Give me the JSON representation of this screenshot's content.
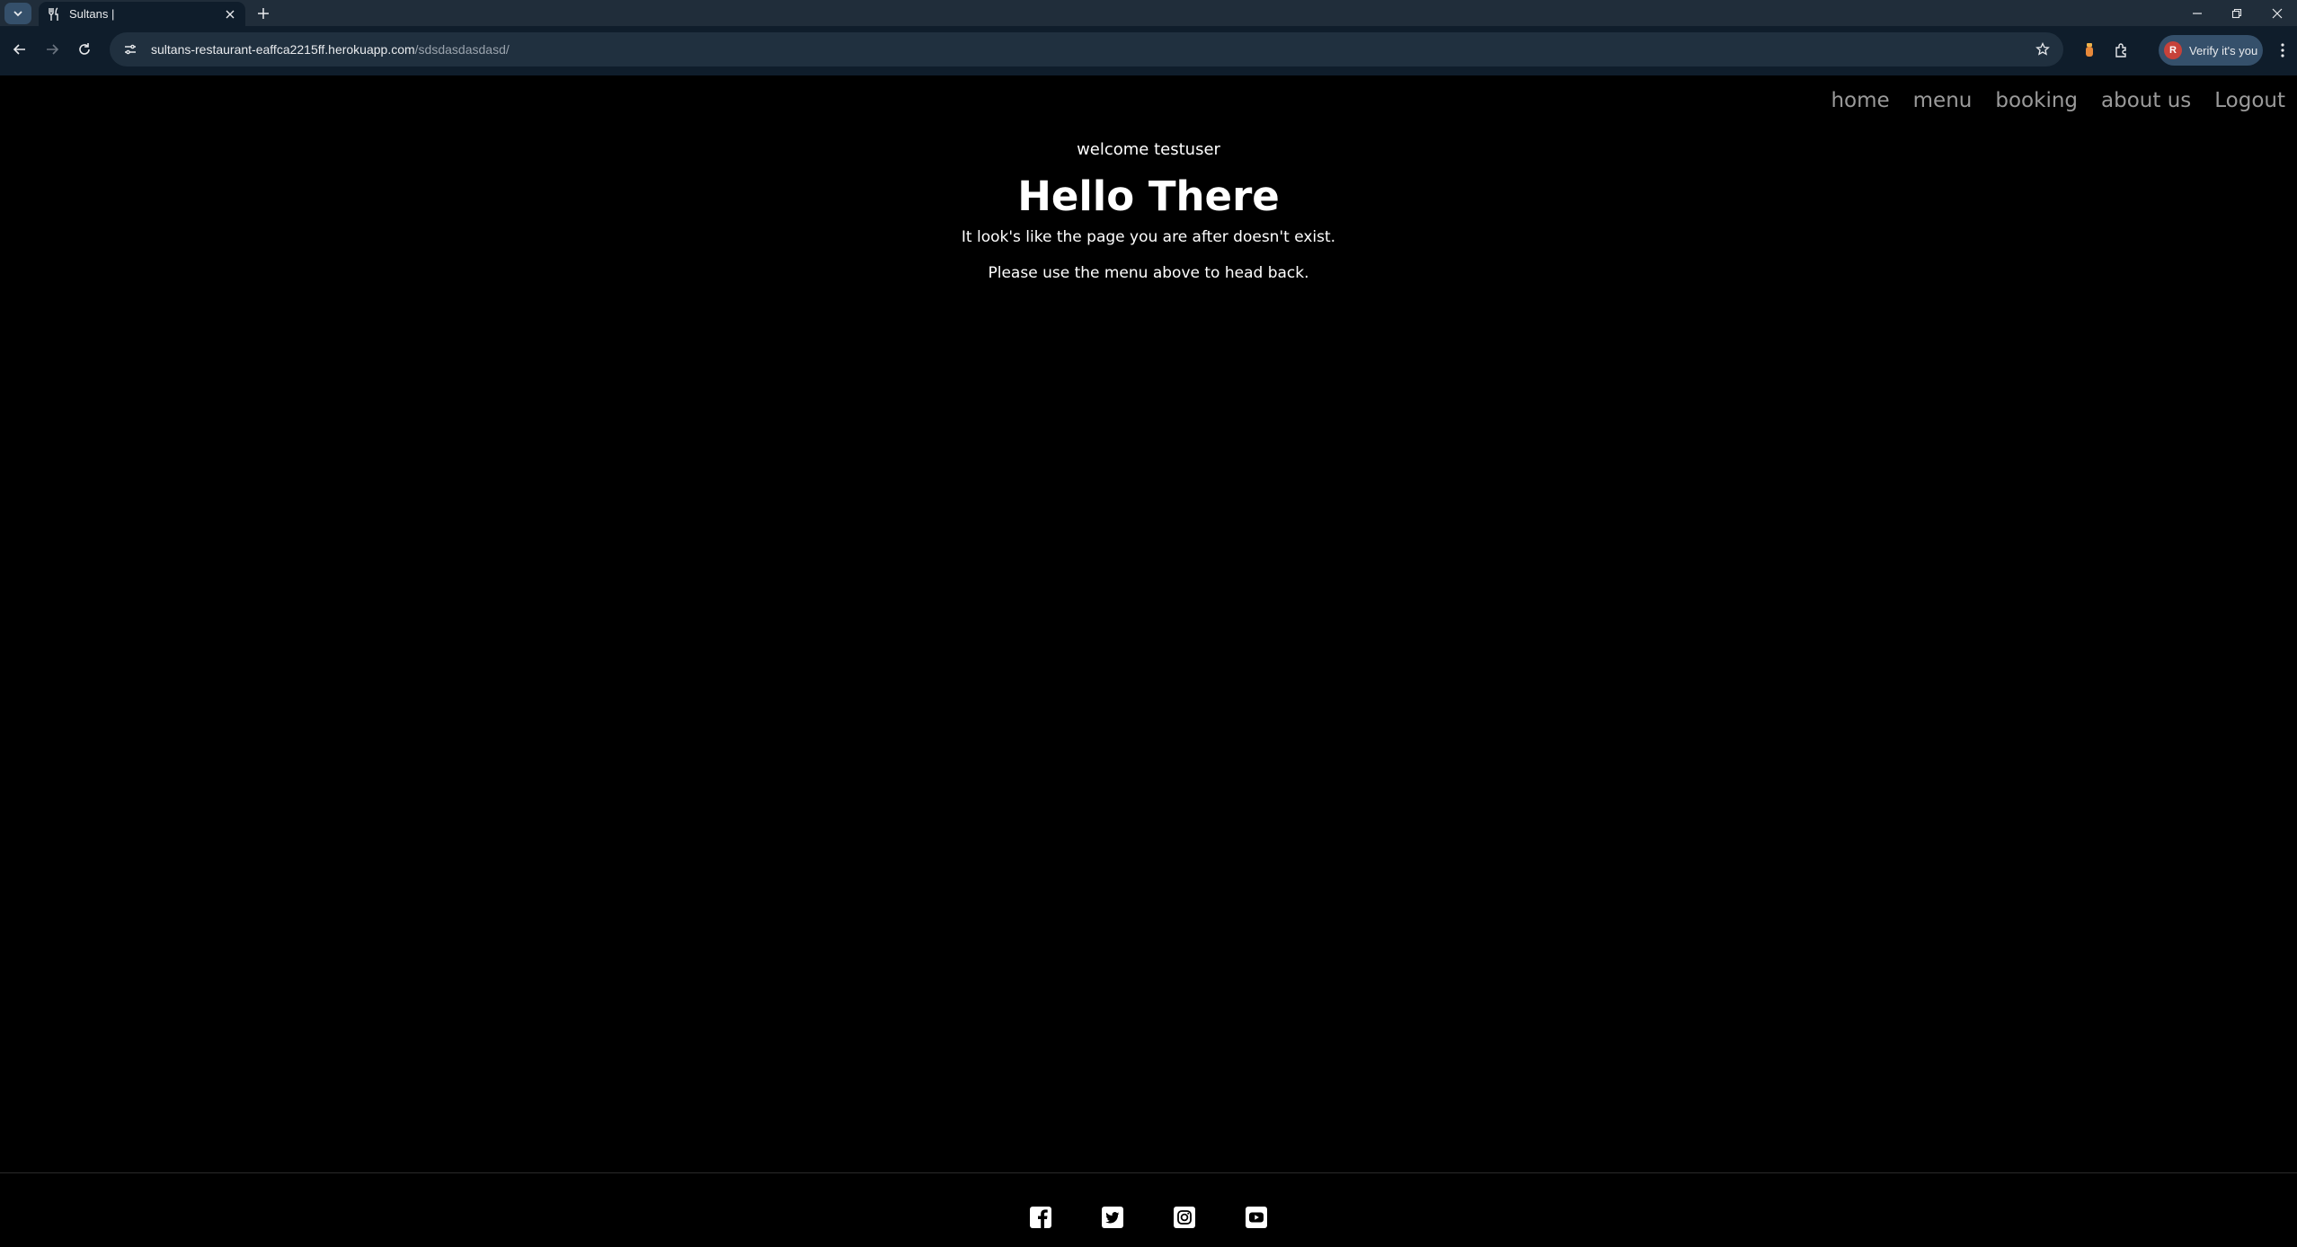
{
  "browser": {
    "tab": {
      "title": "Sultans |"
    },
    "address": {
      "host": "sultans-restaurant-eaffca2215ff.herokuapp.com",
      "path": "/sdsdasdasdasd/"
    },
    "profile": {
      "initial": "R",
      "label": "Verify it's you"
    }
  },
  "nav": {
    "items": [
      {
        "label": "home"
      },
      {
        "label": "menu"
      },
      {
        "label": "booking"
      },
      {
        "label": "about us"
      },
      {
        "label": "Logout"
      }
    ]
  },
  "main": {
    "welcome": "welcome testuser",
    "heading": "Hello There",
    "message1": "It look's like the page you are after doesn't exist.",
    "message2": "Please use the menu above to head back."
  },
  "footer": {
    "social": [
      "facebook-icon",
      "twitter-icon",
      "instagram-icon",
      "youtube-icon"
    ]
  },
  "colors": {
    "background": "#000000",
    "nav_text": "#9a9a9a",
    "chrome_tabstrip": "#202d3a",
    "chrome_toolbar": "#0f1d2b"
  }
}
